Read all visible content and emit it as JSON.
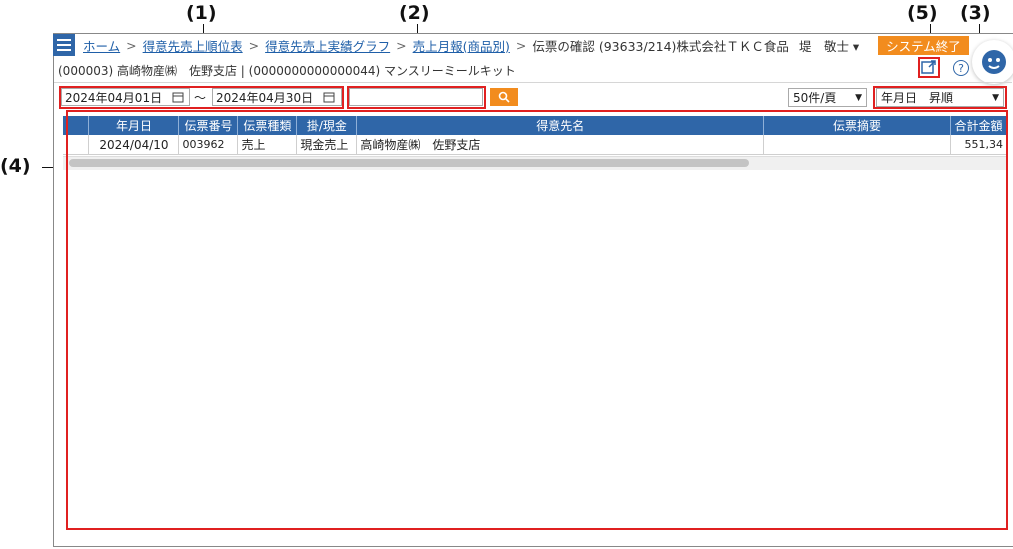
{
  "callouts": [
    "(1)",
    "(2)",
    "(5)",
    "(3)",
    "(4)"
  ],
  "breadcrumb": [
    {
      "label": "ホーム"
    },
    {
      "label": "得意先売上順位表"
    },
    {
      "label": "得意先売上実績グラフ"
    },
    {
      "label": "売上月報(商品別)"
    }
  ],
  "breadcrumb_sep": ">",
  "current_page": "伝票の確認 (93633/214)株式会社ＴＫＣ食品",
  "user_name": "堤　敬士 ▾",
  "system_exit_label": "システム終了",
  "subline": "(000003) 高崎物産㈱　佐野支店 | (0000000000000044) マンスリーミールキット",
  "help_label": "?",
  "date_from": "2024年04月01日",
  "date_to": "2024年04月30日",
  "tilde": "～",
  "search": {
    "value": "",
    "placeholder": ""
  },
  "page_size": "50件/頁",
  "sort_order": "年月日　昇順",
  "table": {
    "headers": [
      "",
      "年月日",
      "伝票番号",
      "伝票種類",
      "掛/現金",
      "得意先名",
      "伝票摘要",
      "合計金額"
    ],
    "rows": [
      [
        "",
        "2024/04/10",
        "003962",
        "売上",
        "現金売上",
        "高崎物産㈱　佐野支店",
        "",
        "551,34"
      ]
    ]
  },
  "colors": {
    "accent": "#2f66a8",
    "orange": "#f28c1e",
    "callout_red": "#e02020"
  },
  "icons": [
    "menu-icon",
    "calendar-icon",
    "search-icon",
    "external-link-icon",
    "help-icon",
    "assistant-face-icon",
    "chevron-down-icon"
  ]
}
